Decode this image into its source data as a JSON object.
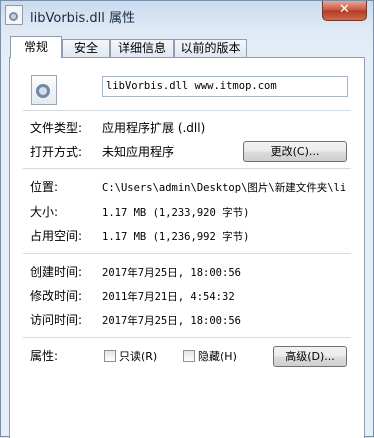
{
  "window": {
    "title": "libVorbis.dll 属性",
    "close_glyph": "✕"
  },
  "tabs": [
    {
      "label": "常规",
      "active": true
    },
    {
      "label": "安全",
      "active": false
    },
    {
      "label": "详细信息",
      "active": false
    },
    {
      "label": "以前的版本",
      "active": false
    }
  ],
  "file": {
    "name": "libVorbis.dll www.itmop.com"
  },
  "props": {
    "type_label": "文件类型:",
    "type_value": "应用程序扩展 (.dll)",
    "opens_label": "打开方式:",
    "opens_value": "未知应用程序",
    "change_button": "更改(C)...",
    "location_label": "位置:",
    "location_value": "C:\\Users\\admin\\Desktop\\图片\\新建文件夹\\li",
    "size_label": "大小:",
    "size_value": "1.17 MB (1,233,920 字节)",
    "disk_label": "占用空间:",
    "disk_value": "1.17 MB (1,236,992 字节)",
    "created_label": "创建时间:",
    "created_value": "2017年7月25日, 18:00:56",
    "modified_label": "修改时间:",
    "modified_value": "2011年7月21日, 4:54:32",
    "accessed_label": "访问时间:",
    "accessed_value": "2017年7月25日, 18:00:56",
    "attributes_label": "属性:",
    "readonly_label": "只读(R)",
    "hidden_label": "隐藏(H)",
    "advanced_button": "高级(D)..."
  },
  "icons": {
    "app": "dll-gear-icon",
    "file": "dll-file-icon",
    "close": "close-icon"
  }
}
